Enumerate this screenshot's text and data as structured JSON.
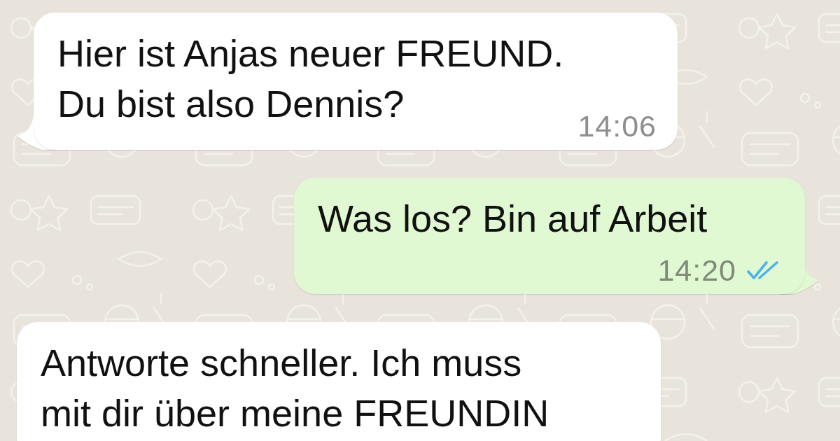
{
  "messages": [
    {
      "kind": "incoming",
      "text": "Hier ist Anjas neuer FREUND.\nDu bist also Dennis?",
      "time": "14:06"
    },
    {
      "kind": "outgoing",
      "text": "Was los? Bin auf Arbeit",
      "time": "14:20",
      "read": true
    },
    {
      "kind": "incoming",
      "text": "Antworte schneller. Ich muss\nmit dir über meine FREUNDIN"
    }
  ]
}
